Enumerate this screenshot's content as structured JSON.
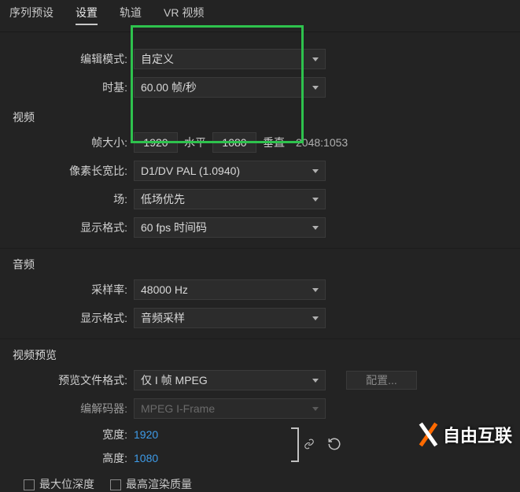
{
  "tabs": {
    "preset": "序列预设",
    "settings": "设置",
    "tracks": "轨道",
    "vr": "VR 视频"
  },
  "labels": {
    "editMode": "编辑模式:",
    "timebase": "时基:",
    "frameSize": "帧大小:",
    "horizontal": "水平",
    "vertical": "垂直",
    "pixelAspect": "像素长宽比:",
    "fields": "场:",
    "displayFormat": "显示格式:",
    "sampleRate": "采样率:",
    "audioDisplayFormat": "显示格式:",
    "previewFormat": "预览文件格式:",
    "codec": "编解码器:",
    "width": "宽度:",
    "height": "高度:"
  },
  "values": {
    "editMode": "自定义",
    "timebase": "60.00 帧/秒",
    "frameW": "1920",
    "frameH": "1080",
    "ratioText": "2048:1053",
    "pixelAspect": "D1/DV PAL (1.0940)",
    "fields": "低场优先",
    "displayFormat": "60 fps 时间码",
    "sampleRate": "48000 Hz",
    "audioDisplayFormat": "音频采样",
    "previewFormat": "仅 I 帧 MPEG",
    "codec": "MPEG I-Frame",
    "previewW": "1920",
    "previewH": "1080"
  },
  "sections": {
    "video": "视频",
    "audio": "音频",
    "preview": "视频预览"
  },
  "buttons": {
    "configure": "配置..."
  },
  "checkboxes": {
    "maxBitDepth": "最大位深度",
    "maxRenderQuality": "最高渲染质量"
  },
  "watermark": "自由互联"
}
